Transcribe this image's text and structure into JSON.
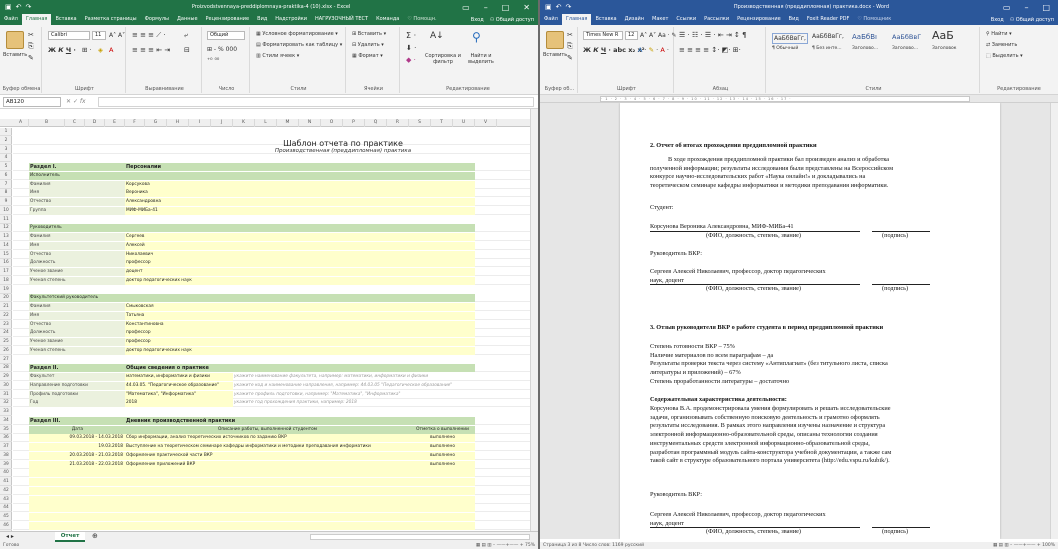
{
  "excel": {
    "title": "Proizvodstvennaya-preddiplomnaya-praktika-4 (10).xlsx - Excel",
    "tabs": [
      "Файл",
      "Главная",
      "Вставка",
      "Разметка страницы",
      "Формулы",
      "Данные",
      "Рецензирование",
      "Вид",
      "Надстройки",
      "НАГРУЗОЧНЫЙ ТЕСТ",
      "Команда"
    ],
    "tell_me": "♡ Помощн.",
    "login": "Вход",
    "share": "Общий доступ",
    "ribbon": {
      "paste": "Вставить",
      "font_name": "Calibri",
      "font_size": "11",
      "number_format": "Общий",
      "cond_format": "Условное форматирование",
      "format_table": "Форматировать как таблицу",
      "cell_styles": "Стили ячеек",
      "insert": "Вставить",
      "delete": "Удалить",
      "format": "Формат",
      "sort_filter": "Сортировка и фильтр",
      "find_select": "Найти и выделить",
      "groups": [
        "Буфер обмена",
        "Шрифт",
        "Выравнивание",
        "Число",
        "Стили",
        "Ячейки",
        "Редактирование"
      ]
    },
    "name_box": "AB120",
    "columns": [
      "A",
      "B",
      "C",
      "D",
      "E",
      "F",
      "G",
      "H",
      "I",
      "J",
      "K",
      "L",
      "M",
      "N",
      "O",
      "P",
      "Q",
      "R",
      "S",
      "T",
      "U",
      "V"
    ],
    "rows": [
      "1",
      "2",
      "3",
      "4",
      "5",
      "6",
      "7",
      "8",
      "9",
      "10",
      "11",
      "12",
      "13",
      "14",
      "15",
      "16",
      "17",
      "18",
      "19",
      "20",
      "21",
      "22",
      "23",
      "24",
      "25",
      "26",
      "27",
      "28",
      "29",
      "30",
      "31",
      "32",
      "33",
      "34",
      "35",
      "36",
      "37",
      "38",
      "39",
      "40",
      "41",
      "42",
      "43",
      "44",
      "45",
      "46"
    ],
    "sheet_title": "Шаблон отчета по практике",
    "sheet_subtitle": "Производственная (преддипломная) практика",
    "section1": {
      "label": "Раздел I.",
      "name": "Персоналии"
    },
    "executor_label": "Исполнитель",
    "executor": [
      [
        "Фамилия",
        "Корсукова"
      ],
      [
        "Имя",
        "Вероника"
      ],
      [
        "Отчество",
        "Александровна"
      ],
      [
        "Группа",
        "МИФ-МИБа-41"
      ]
    ],
    "leader_label": "Руководитель",
    "leader": [
      [
        "Фамилия",
        "Сергеев"
      ],
      [
        "Имя",
        "Алексей"
      ],
      [
        "Отчество",
        "Николаевич"
      ],
      [
        "Должность",
        "профессор"
      ],
      [
        "Ученое звание",
        "доцент"
      ],
      [
        "Ученая степень",
        "доктор педагогических наук"
      ]
    ],
    "faculty_label": "Факультетский руководитель",
    "faculty": [
      [
        "Фамилия",
        "Смыковская"
      ],
      [
        "Имя",
        "Татьяна"
      ],
      [
        "Отчество",
        "Константиновна"
      ],
      [
        "Должность",
        "профессор"
      ],
      [
        "Ученое звание",
        "профессор"
      ],
      [
        "Ученая степень",
        "доктор педагогических наук"
      ]
    ],
    "section2": {
      "label": "Раздел II.",
      "name": "Общие сведения о практике"
    },
    "general": [
      [
        "Факультет",
        "математики, информатики и физики",
        "укажите наименование факультета, например: математики, информатики и физики"
      ],
      [
        "Направление подготовки",
        "44.03.05. \"Педагогическое образование\"",
        "укажите код и наименование направления, например: 44.03.05 \"Педагогическое образование\""
      ],
      [
        "Профиль подготовки",
        "\"Математика\", \"Информатика\"",
        "укажите профиль подготовки, например: \"Математика\", \"Информатика\""
      ],
      [
        "Год",
        "2018",
        "укажите год прохождения практики, например: 2018"
      ]
    ],
    "section3": {
      "label": "Раздел III.",
      "name": "Дневник производственной практики"
    },
    "diary_headers": [
      "Дата",
      "Описание работы, выполненной студентом",
      "Отметка о выполнении"
    ],
    "diary": [
      [
        "09.03.2018 - 14.03.2018",
        "Сбор информации, анализ теоретических источников по заданию ВКР",
        "выполнено"
      ],
      [
        "19.03.2018",
        "Выступление на теоретическом семинаре кафедры информатики и методики преподавания информатики",
        "выполнено"
      ],
      [
        "20.03.2018 - 21.03.2018",
        "Оформление практической части ВКР",
        "выполнено"
      ],
      [
        "21.03.2018 - 22.03.2018",
        "Оформление приложений ВКР",
        "выполнено"
      ]
    ],
    "sheet_tab": "Отчет",
    "status": "Готово",
    "zoom": "75%"
  },
  "word": {
    "title": "Производственная (преддипломная) практика.docx - Word",
    "tabs": [
      "Файл",
      "Главная",
      "Вставка",
      "Дизайн",
      "Макет",
      "Ссылки",
      "Рассылки",
      "Рецензирование",
      "Вид",
      "Foxit Reader PDF"
    ],
    "tell_me": "♡ Помощник",
    "login": "Вход",
    "share": "Общий доступ",
    "ribbon": {
      "paste": "Вставить",
      "font_name": "Times New R",
      "font_size": "12",
      "styles": [
        "АаБбВвГг,",
        "АаБбВвГг,",
        "АаБбВı",
        "АаБбВвГ",
        "АаБ"
      ],
      "style_names": [
        "¶ Обычный",
        "¶ Без инте...",
        "Заголово...",
        "Заголово...",
        "Заголовок"
      ],
      "find": "Найти",
      "replace": "Заменить",
      "select": "Выделить",
      "groups": [
        "Буфер об...",
        "Шрифт",
        "Абзац",
        "Стили",
        "Редактирование"
      ]
    },
    "doc": {
      "h2": "2. Отчет об итогах прохождения преддипломной практики",
      "p1": [
        "В ходе прохождения преддипломной практики бал произведен анализ и обработка",
        "полученной информации; результаты исследования были представлены на Всероссийском",
        "конкурсе научно-исследовательских работ «Наука онлайн!» и докладывались на",
        "теоретическом семинаре кафедры информатики и методики преподавания информатики."
      ],
      "student_label": "Студент:",
      "student_name": "Корсунова Вероника Александровна, МИФ-МИБа-41",
      "fio_caption": "(ФИО, должность, степень, звание)",
      "sign_caption": "(подпись)",
      "leader_label": "Руководитель ВКР:",
      "leader_name_1": "Сергеев Алексей Николаевич, профессор, доктор педагогических",
      "leader_name_2": "наук, доцент",
      "h3": "3. Отзыв руководителя ВКР о работе студента в период преддипломной практики",
      "list": [
        "Степень готовности ВКР – 75%",
        "Наличие материалов по всем параграфам – да",
        "Результаты проверки текста через систему «Антиплагиат» (без титульного листа, списка",
        "литературы и приложений) – 67%",
        "Степень проработанности литературы – достаточно"
      ],
      "content_title": "Содержательная характеристика деятельности:",
      "content": [
        "Корсунова В.А. продемонстрировала умения формулировать и решать исследовательские",
        "задачи, организовывать собственную поисковую деятельность и грамотно оформлять",
        "результаты исследования. В рамках этого направления изучены назначение и структура",
        "электронной информационно-образовательной среды, описаны технологии создания",
        "инструментальных средств электронной информационно-образовательной среды,",
        "разработан программный модуль сайта-конструктора учебной документации, а также сам",
        "такой сайт в структуре образовательного портала университета (http://edu.vspu.ru/kubik/)."
      ],
      "leader_label_2": "Руководитель ВКР:"
    },
    "status": "Страница 3 из 8   Число слов: 1169   русский",
    "zoom": "100%"
  },
  "colors": {
    "excel_green": "#217346",
    "word_blue": "#2b579a",
    "section_green": "#c6e0b4"
  }
}
